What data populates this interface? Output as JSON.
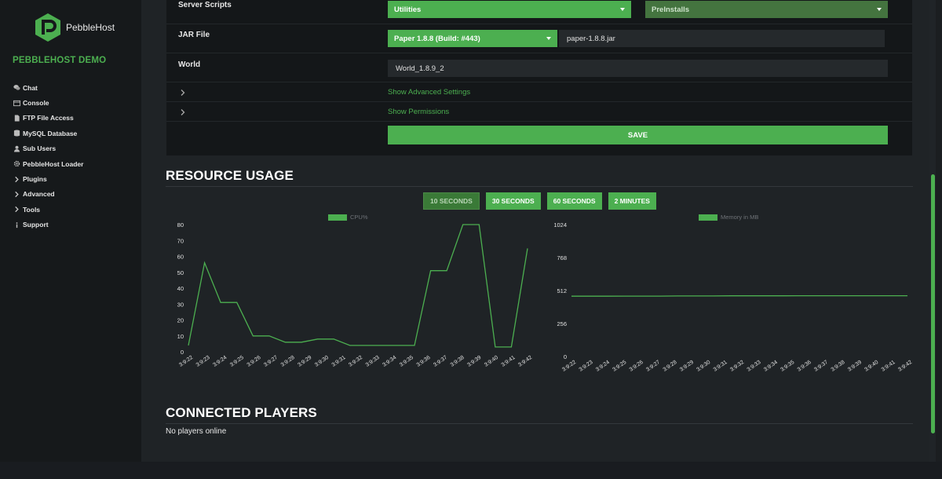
{
  "app": {
    "brand": "PebbleHost",
    "project": "PEBBLEHOST DEMO"
  },
  "sidebar": {
    "items": [
      {
        "label": "Chat",
        "icon": "chat-icon"
      },
      {
        "label": "Console",
        "icon": "console-icon"
      },
      {
        "label": "FTP File Access",
        "icon": "file-icon"
      },
      {
        "label": "MySQL Database",
        "icon": "database-icon"
      },
      {
        "label": "Sub Users",
        "icon": "users-icon"
      },
      {
        "label": "PebbleHost Loader",
        "icon": "gear-icon"
      },
      {
        "label": "Plugins",
        "icon": "chevron-right-icon"
      },
      {
        "label": "Advanced",
        "icon": "chevron-right-icon"
      },
      {
        "label": "Tools",
        "icon": "chevron-right-icon"
      },
      {
        "label": "Support",
        "icon": "info-icon"
      }
    ]
  },
  "settings": {
    "server_scripts_label": "Server Scripts",
    "server_scripts_value": "Utilities",
    "preinstalls_value": "PreInstalls",
    "jar_label": "JAR File",
    "jar_select_value": "Paper 1.8.8 (Build: #443)",
    "jar_file_value": "paper-1.8.8.jar",
    "world_label": "World",
    "world_value": "World_1.8.9_2",
    "advanced_link": "Show Advanced Settings",
    "permissions_link": "Show Permissions",
    "save_label": "SAVE"
  },
  "resource": {
    "title": "RESOURCE USAGE",
    "ranges": [
      "10 SECONDS",
      "30 SECONDS",
      "60 SECONDS",
      "2 MINUTES"
    ],
    "active_range": "10 SECONDS"
  },
  "players": {
    "title": "CONNECTED PLAYERS",
    "empty_text": "No players online"
  },
  "colors": {
    "accent": "#4caf50",
    "background": "#1f2326",
    "card": "#141719"
  },
  "chart_data": [
    {
      "type": "line",
      "series": [
        {
          "name": "CPU%",
          "values": [
            4,
            56,
            31,
            31,
            10,
            10,
            6,
            6,
            8,
            8,
            4,
            4,
            4,
            4,
            4,
            51,
            51,
            80,
            80,
            3,
            3,
            65
          ]
        }
      ],
      "x": [
        "3:9:22",
        "3:9:23",
        "3:9:24",
        "3:9:25",
        "3:9:26",
        "3:9:27",
        "3:9:28",
        "3:9:29",
        "3:9:30",
        "3:9:31",
        "3:9:32",
        "3:9:33",
        "3:9:34",
        "3:9:35",
        "3:9:36",
        "3:9:37",
        "3:9:38",
        "3:9:39",
        "3:9:40",
        "3:9:41",
        "3:9:42"
      ],
      "yticks": [
        0,
        10,
        20,
        30,
        40,
        50,
        60,
        70,
        80
      ],
      "ylim": [
        0,
        80
      ],
      "grid": false,
      "legend": "top"
    },
    {
      "type": "line",
      "series": [
        {
          "name": "Memory in MB",
          "values": [
            468,
            468,
            468,
            469,
            469,
            469,
            470,
            470,
            470,
            471,
            471,
            471,
            471,
            472,
            472,
            472,
            472,
            472,
            472,
            472
          ]
        }
      ],
      "x": [
        "3:9:22",
        "3:9:23",
        "3:9:24",
        "3:9:25",
        "3:9:26",
        "3:9:27",
        "3:9:28",
        "3:9:29",
        "3:9:30",
        "3:9:31",
        "3:9:32",
        "3:9:33",
        "3:9:34",
        "3:9:35",
        "3:9:36",
        "3:9:37",
        "3:9:38",
        "3:9:39",
        "3:9:40",
        "3:9:41",
        "3:9:42"
      ],
      "yticks": [
        0,
        256,
        512,
        768,
        1024
      ],
      "ylim": [
        0,
        1024
      ],
      "grid": false,
      "legend": "top"
    }
  ]
}
